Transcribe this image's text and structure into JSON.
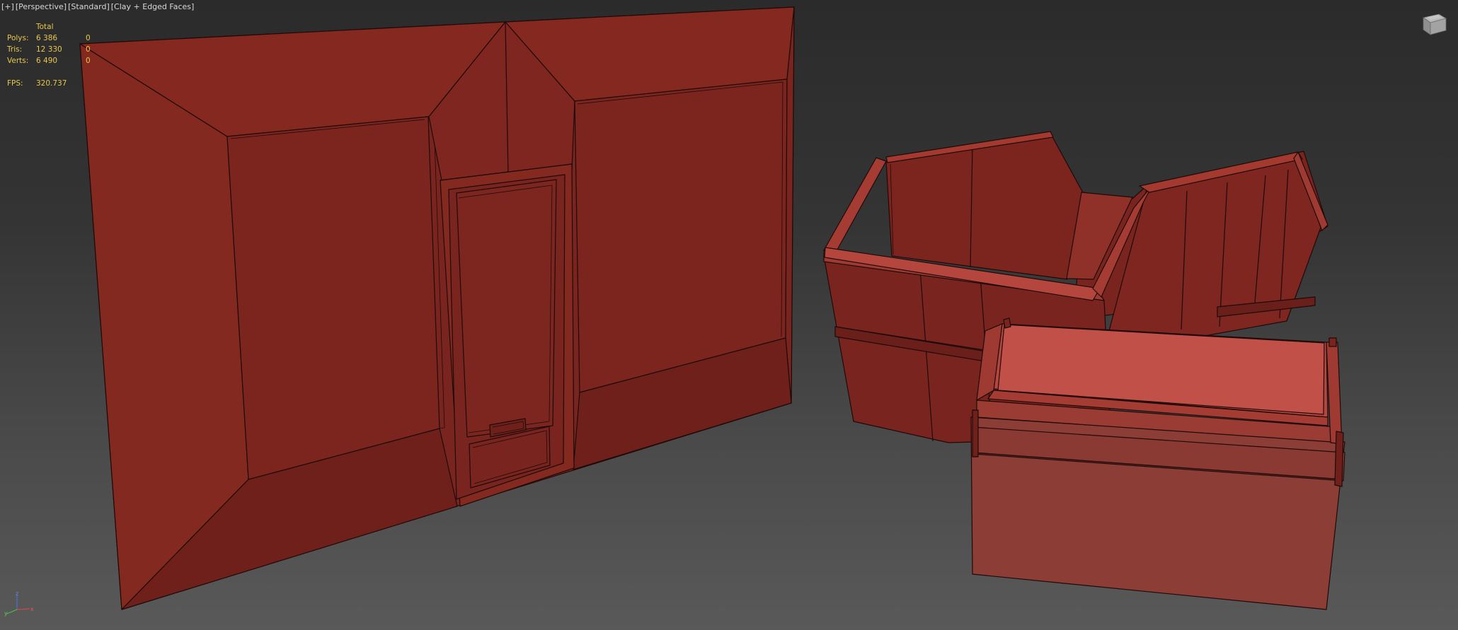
{
  "viewport": {
    "labels": [
      "[+]",
      "[Perspective]",
      "[Standard]",
      "[Clay + Edged Faces]"
    ]
  },
  "stats": {
    "header": "Total",
    "rows": [
      {
        "label": "Polys:",
        "total": "6 386",
        "selected": "0"
      },
      {
        "label": "Tris:",
        "total": "12 330",
        "selected": "0"
      },
      {
        "label": "Verts:",
        "total": "6 490",
        "selected": "0"
      }
    ],
    "fps_label": "FPS:",
    "fps_value": "320.737"
  },
  "viewcube": {
    "icon": "viewcube-icon"
  },
  "axis": {
    "x": "x",
    "y": "y",
    "z": "z"
  },
  "colors": {
    "clay": "#7d2620",
    "clay_light": "#9e3a32",
    "clay_highlight": "#b4463e",
    "edge": "#1e0a08",
    "stats_text": "#e8c84a",
    "label_text": "#d8d8d8"
  }
}
